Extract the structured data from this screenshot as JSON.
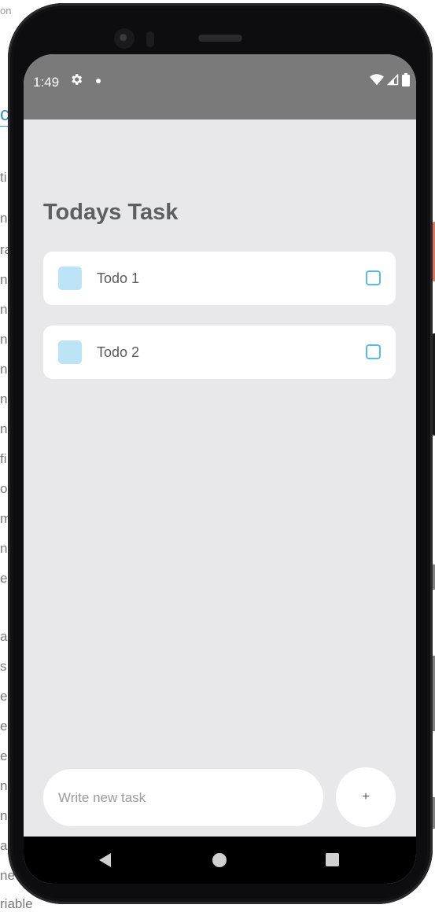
{
  "background": {
    "top_fragment": "on",
    "link_fragment": "c",
    "left_fragments": [
      "ti",
      "ns",
      "ra",
      "ns",
      "ns",
      "ns",
      "ns",
      "ns",
      "ns",
      "fi",
      "on",
      "m",
      "ng",
      "e",
      "a",
      "s",
      "e",
      "e",
      "e",
      "n",
      "ng",
      "al",
      "ne",
      "riable"
    ]
  },
  "statusbar": {
    "time": "1:49"
  },
  "app": {
    "title": "Todays Task",
    "tasks": [
      {
        "label": "Todo 1"
      },
      {
        "label": "Todo 2"
      }
    ],
    "input_placeholder": "Write new task",
    "add_button_label": "+"
  },
  "colors": {
    "accent": "#55bce8",
    "task_square": "#bde3f7",
    "app_background": "#e8e8eb",
    "statusbar": "#7a7a7a"
  },
  "icons": {
    "status_settings": "gear-icon",
    "status_notification": "dot-icon",
    "status_wifi": "wifi-icon",
    "status_signal": "signal-icon",
    "status_battery": "battery-icon",
    "nav_back": "back-icon",
    "nav_home": "home-icon",
    "nav_recents": "recents-icon"
  }
}
